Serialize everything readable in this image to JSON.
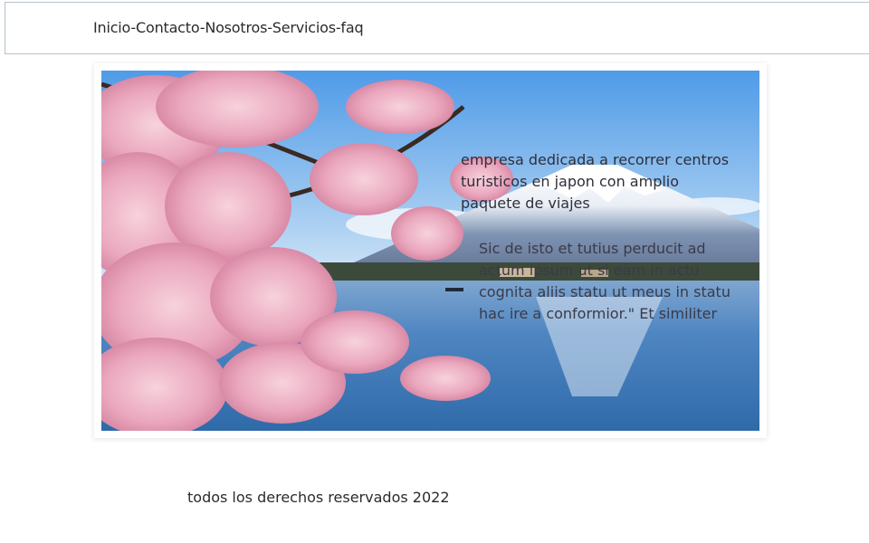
{
  "nav": {
    "links_text": "Inicio-Contacto-Nosotros-Servicios-faq"
  },
  "hero": {
    "image_icon": "mount-fuji-cherry-blossom-photo",
    "description": "empresa dedicada a recorrer centros turisticos en japon con amplio paquete de viajes",
    "quote": "Sic de isto et tutius perducit ad actum ipsum ut si eam in actu cognita aliis statu ut meus in statu hac ire a conformior.\" Et similiter circa alias"
  },
  "footer": {
    "copyright": "todos los derechos reservados 2022"
  },
  "colors": {
    "sky_top": "#5aa3e8",
    "lake": "#3f78b8",
    "blossom": "#f0b6c8",
    "border": "#b7c3c7"
  }
}
